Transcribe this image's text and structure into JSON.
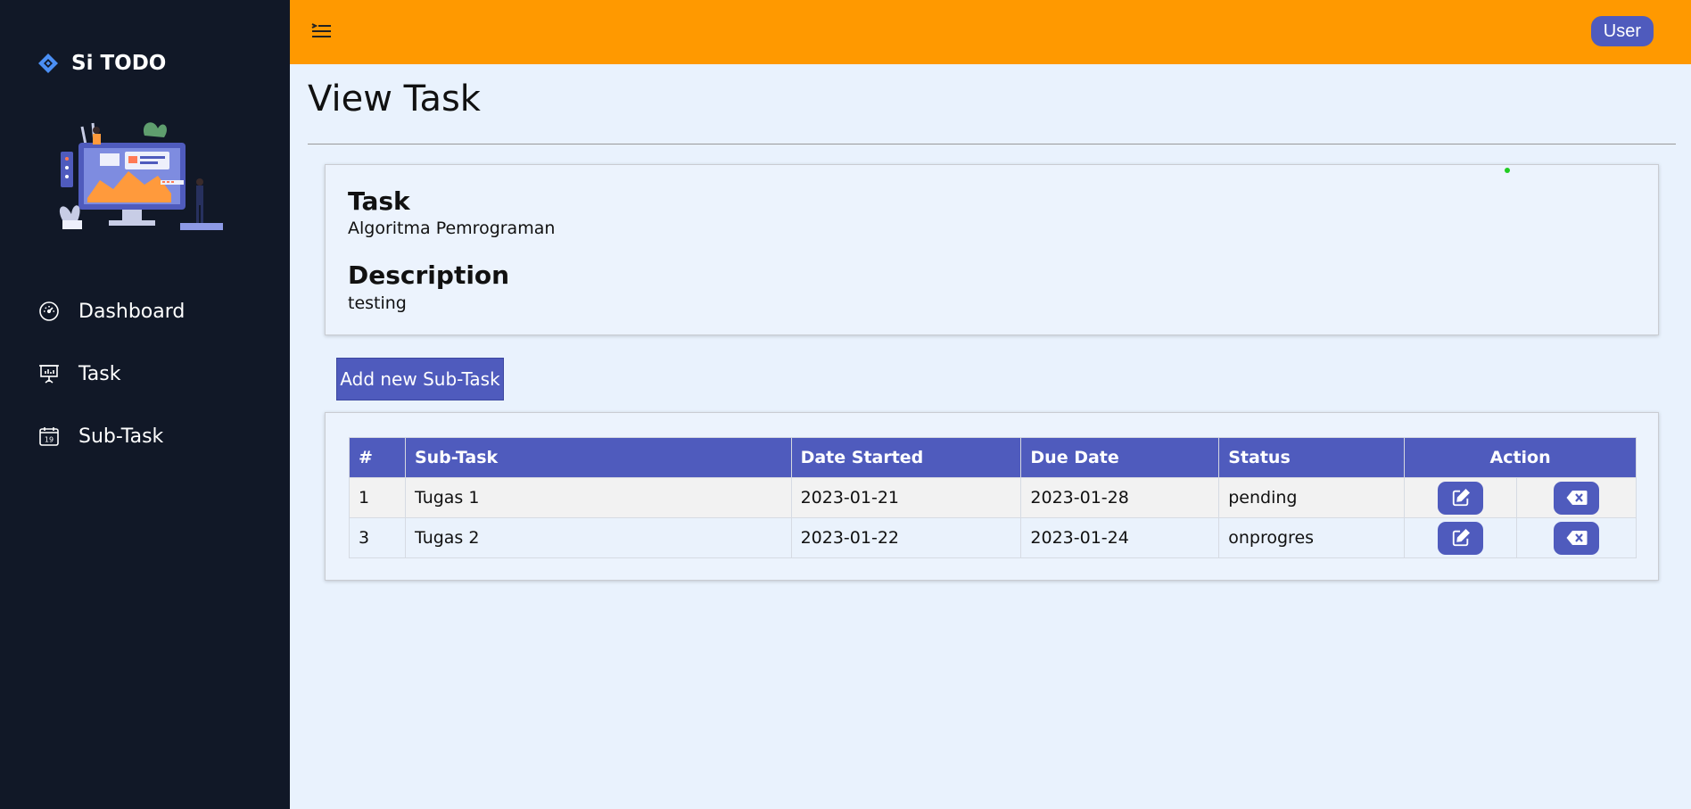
{
  "sidebar": {
    "brand": "Si TODO",
    "items": [
      {
        "label": "Dashboard",
        "icon": "gauge-icon"
      },
      {
        "label": "Task",
        "icon": "presentation-icon"
      },
      {
        "label": "Sub-Task",
        "icon": "calendar-icon",
        "calendar_day": "19"
      }
    ]
  },
  "topbar": {
    "user_label": "User"
  },
  "page": {
    "title": "View Task"
  },
  "task_card": {
    "task_heading": "Task",
    "task_value": "Algoritma Pemrograman",
    "description_heading": "Description",
    "description_value": "testing"
  },
  "add_button_label": "Add new Sub-Task",
  "table": {
    "columns": [
      "#",
      "Sub-Task",
      "Date Started",
      "Due Date",
      "Status",
      "Action"
    ],
    "rows": [
      {
        "no": "1",
        "subtask": "Tugas 1",
        "date_started": "2023-01-21",
        "due_date": "2023-01-28",
        "status": "pending"
      },
      {
        "no": "3",
        "subtask": "Tugas 2",
        "date_started": "2023-01-22",
        "due_date": "2023-01-24",
        "status": "onprogres"
      }
    ]
  },
  "colors": {
    "sidebar_bg": "#111827",
    "topbar_bg": "#ff9900",
    "accent": "#4f5bbd",
    "page_bg": "#e9f2fd"
  }
}
